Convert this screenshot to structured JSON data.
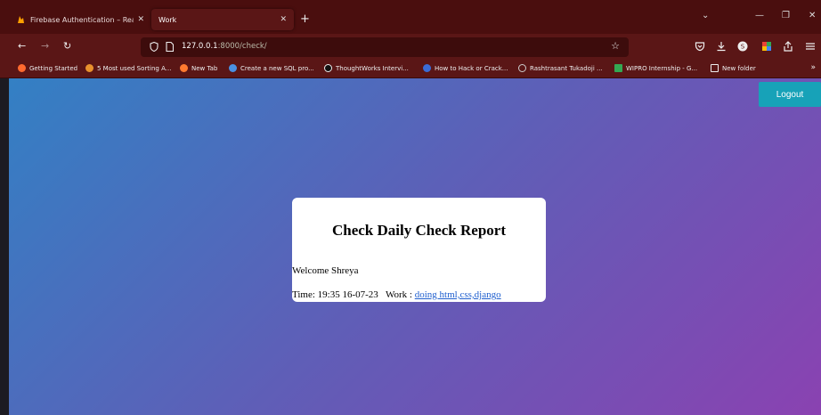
{
  "browser": {
    "tabs": [
      {
        "label": "Firebase Authentication – Realtim",
        "active": false
      },
      {
        "label": "Work",
        "active": true
      }
    ],
    "url_host": "127.0.0.1",
    "url_rest": ":8000/check/",
    "bookmarks": [
      {
        "label": "Getting Started",
        "color": "#ff6a2f"
      },
      {
        "label": "5 Most used Sorting A...",
        "color": "#e8912d"
      },
      {
        "label": "New Tab",
        "color": "#ff7a30"
      },
      {
        "label": "Create a new SQL pro...",
        "color": "#4a90e2"
      },
      {
        "label": "ThoughtWorks Intervi...",
        "color": "#111111"
      },
      {
        "label": "How to Hack or Crack...",
        "color": "#3b6cd6"
      },
      {
        "label": "Rashtrasant Tukadoji ...",
        "color": "#cccccc"
      },
      {
        "label": "WIPRO Internship - G...",
        "color": "#34a853"
      },
      {
        "label": "New folder",
        "color": "none"
      }
    ]
  },
  "page": {
    "logout_label": "Logout",
    "title": "Check Daily Check Report",
    "welcome": "Welcome Shreya",
    "entry_time": "Time: 19:35 16-07-23",
    "entry_work_label": "Work :",
    "entry_work_value": "doing html,css,django"
  },
  "colors": {
    "gradient_start": "#3380c4",
    "gradient_end": "#8a42b1",
    "logout_bg": "#17a2b8",
    "browser_chrome": "#5a1616"
  }
}
